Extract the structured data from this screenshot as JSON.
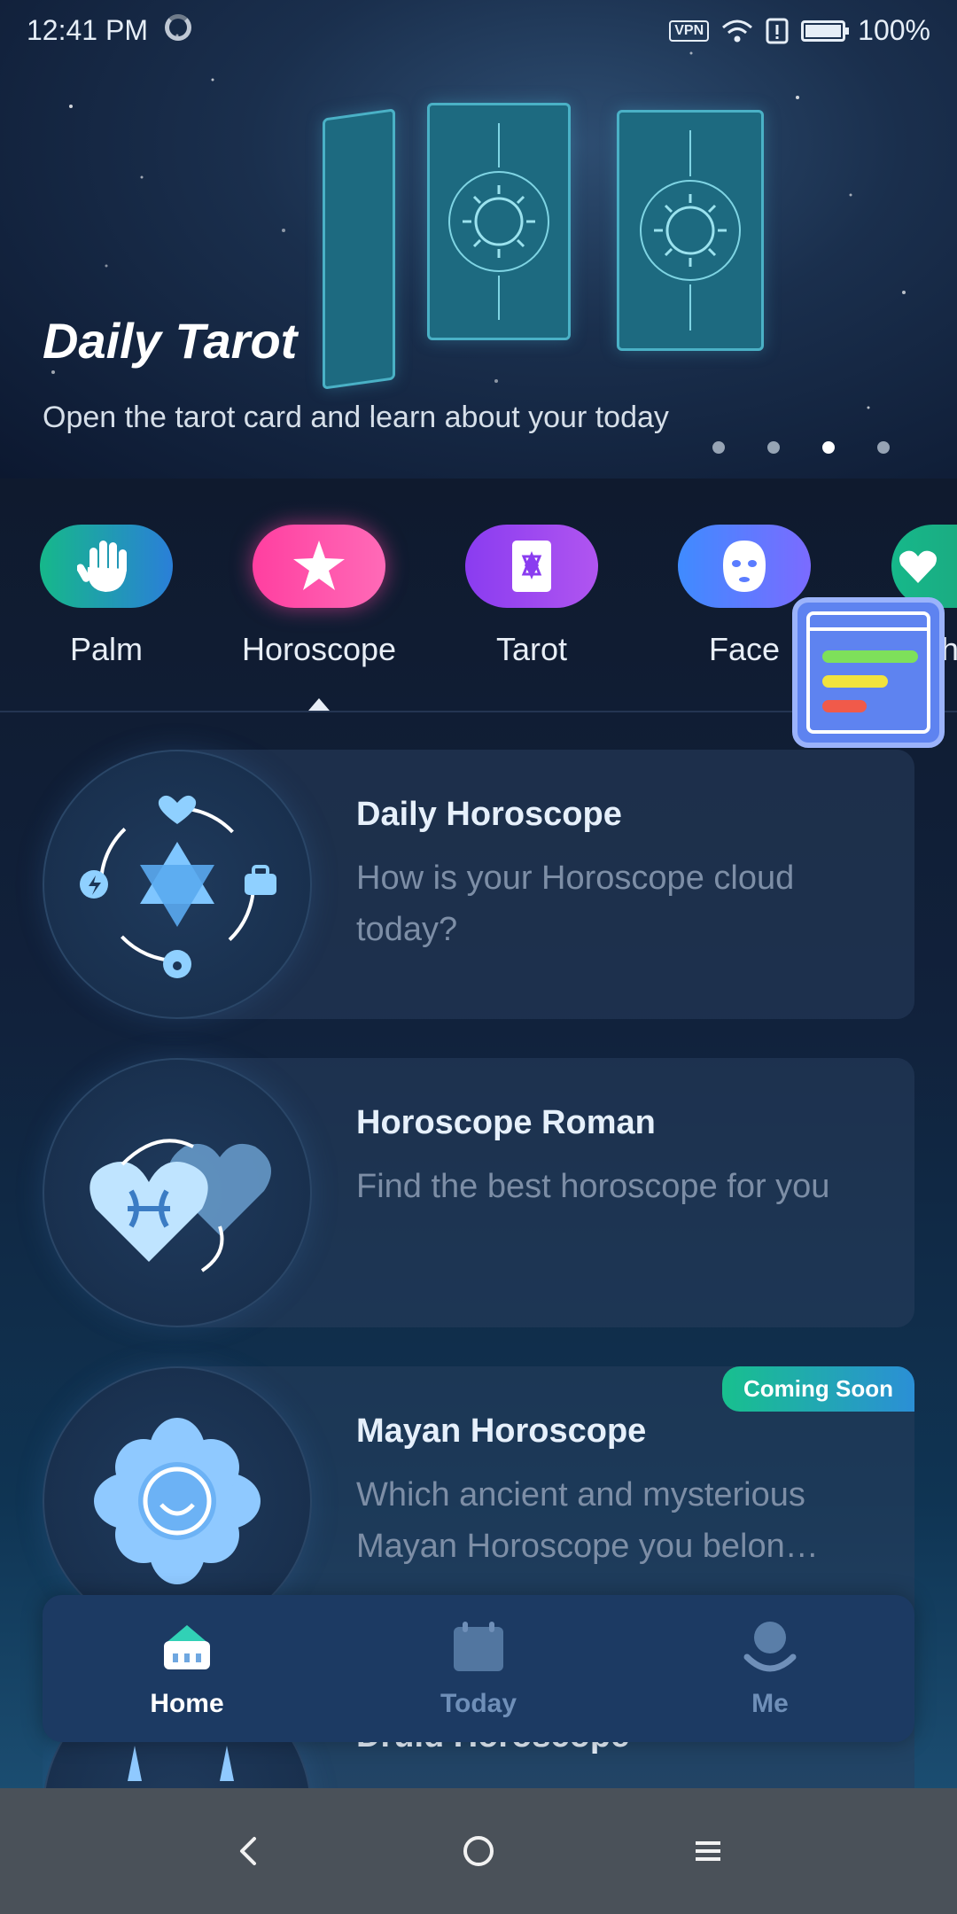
{
  "status_bar": {
    "time": "12:41 PM",
    "vpn": "VPN",
    "battery": "100%"
  },
  "hero": {
    "title": "Daily Tarot",
    "subtitle": "Open the tarot card and learn about your today",
    "page_count": 4,
    "active_page": 3
  },
  "categories": [
    {
      "label": "Palm",
      "icon": "palm-icon",
      "color_from": "#16b88a",
      "color_to": "#2a7fd8"
    },
    {
      "label": "Horoscope",
      "icon": "star-icon",
      "color_from": "#ff3fa0",
      "color_to": "#ff6ab7"
    },
    {
      "label": "Tarot",
      "icon": "tarot-card-icon",
      "color_from": "#8a3cf0",
      "color_to": "#b055f0"
    },
    {
      "label": "Face",
      "icon": "face-icon",
      "color_from": "#3f8bff",
      "color_to": "#7b6bff"
    },
    {
      "label": "h",
      "icon": "heart-icon",
      "color_from": "#16b88a",
      "color_to": "#1fa07a"
    }
  ],
  "selected_category": "Horoscope",
  "cards": [
    {
      "title": "Daily Horoscope",
      "description": "How is your Horoscope cloud today?",
      "icon": "star-of-david-icon"
    },
    {
      "title": "Horoscope Roman",
      "description": "Find the best horoscope for you",
      "icon": "hearts-zodiac-icon"
    },
    {
      "title": "Mayan Horoscope",
      "description": "Which ancient and mysterious Mayan Horoscope you belon…",
      "icon": "mayan-flower-icon",
      "badge": "Coming Soon"
    },
    {
      "title": "Druid Horoscope",
      "description": "",
      "icon": "druid-icon"
    }
  ],
  "bottom_nav": {
    "items": [
      {
        "label": "Home",
        "icon": "home-icon",
        "active": true
      },
      {
        "label": "Today",
        "icon": "calendar-icon",
        "active": false
      },
      {
        "label": "Me",
        "icon": "profile-icon",
        "active": false
      }
    ],
    "active_color": "#ffffff",
    "inactive_color": "#6f8fb8"
  },
  "colors": {
    "accent_teal": "#4ab1c6",
    "background": "#11203a"
  }
}
